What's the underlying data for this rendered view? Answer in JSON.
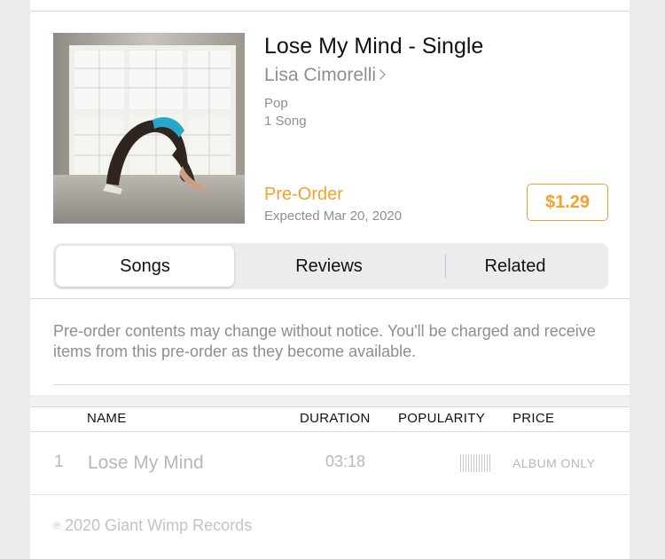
{
  "album": {
    "title": "Lose My Mind - Single",
    "artist": "Lisa Cimorelli",
    "genre": "Pop",
    "song_count": "1 Song",
    "artwork_icon": "album-artwork-image"
  },
  "purchase": {
    "preorder_label": "Pre-Order",
    "expected": "Expected Mar 20, 2020",
    "price": "$1.29",
    "accent_color": "#f4a12e"
  },
  "tabs": [
    {
      "label": "Songs",
      "active": true
    },
    {
      "label": "Reviews",
      "active": false
    },
    {
      "label": "Related",
      "active": false
    }
  ],
  "notice": "Pre-order contents may change without notice. You'll be charged and receive items from this pre-order as they become available.",
  "table": {
    "columns": [
      "NAME",
      "DURATION",
      "POPULARITY",
      "PRICE"
    ],
    "rows": [
      {
        "number": "1",
        "name": "Lose My Mind",
        "duration": "03:18",
        "popularity_icon": "popularity-bars-icon",
        "price": "ALBUM ONLY"
      }
    ]
  },
  "footer": {
    "copyright_symbol": "℗",
    "copyright": "2020 Giant Wimp Records"
  }
}
